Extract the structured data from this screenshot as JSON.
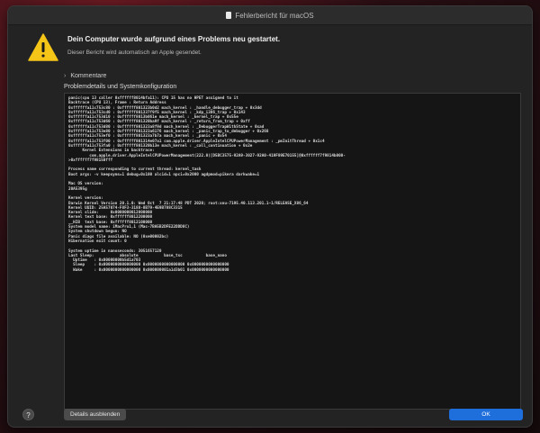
{
  "window": {
    "title": "Fehlerbericht für macOS"
  },
  "header": {
    "headline": "Dein Computer wurde aufgrund eines Problems neu gestartet.",
    "subline": "Dieser Bericht wird automatisch an Apple gesendet."
  },
  "comments": {
    "label": "Kommentare"
  },
  "details": {
    "section_label": "Problemdetails und Systemkonfiguration",
    "report_lines": [
      "panic(cpu 13 caller 0xffffff8014bfa11): CPU 15 has no HPET assigned to it",
      "Backtrace (CPU 13), Frame : Return Address",
      "0xffffffa11c753c80 : 0xffffff801323b0d2 mach_kernel : _handle_debugger_trap + 0x3dd",
      "0xffffffa11c753cd0 : 0xffffff801337f9f5 mach_kernel : _kdp_i386_trap + 0x143",
      "0xffffffa11c753d10 : 0xffffff8013b061e mach_kernel : _kernel_trap + 0x55e",
      "0xffffffa11c753d60 : 0xffffff801320ba9f mach_kernel : _return_from_trap + 0xff",
      "0xffffffa11c753d80 : 0xffffff801323a8f9d mach_kernel : _DebuggerTrapWithState + 0xad",
      "0xffffffa11c753e80 : 0xffffff801323a6176 mach_kernel : _panic_trap_to_debugger + 0x268",
      "0xffffffa11c753ef0 : 0xffffff801323a7b7a mach_kernel : _panic + 0x54",
      "0xffffffa11c753f00 : 0xffffff801314e07a1 com.apple.driver.AppleIntelCPUPowerManagement : _pmInitThread + 0x1c4",
      "0xffffffa11c753fa0 : 0xffffff801320b13e mach_kernel : _call_continuation + 0x2e",
      "      Kernel Extensions in backtrace:",
      "         com.apple.driver.AppleIntelCPUPowerManagement(222.0)[D5BC3575-92A9-3027-92A0-419F89E70155]@0xffffff7f9814b000-",
      ">0xffffff7f98150fff",
      "",
      "Process name corresponding to current thread: kernel_task",
      "Boot args: -v keepsyms=1 debug=0x100 alcid=1 npci=0x2000 agdpmod=pikera darkwake=1",
      "",
      "Mac OS version:",
      "20A5395g",
      "",
      "Kernel version:",
      "Darwin Kernel Version 20.1.0: Wed Oct  7 21:17:48 PDT 2020; root:xnu-7195.40.113.201.1~1/RELEASE_X86_64",
      "Kernel UUID: 25A57074-F8F3-3188-8B79-4E9B788C3315",
      "Kernel slide:     0x0000000012000000",
      "Kernel text base: 0xffffff8012200000",
      "__HIB  text base: 0xffffff8012100000",
      "System model name: iMacPro1,1 (Mac-7BA5B2DFE22DDD8C)",
      "System shutdown begun: NO",
      "Panic diags file available: NO (0xe00002bc)",
      "Hibernation exit count: 0",
      "",
      "System uptime in nanoseconds: 3051657120",
      "Last Sleep:           absolute           base_tsc          base_nano",
      "  Uptime   : 0x00000000b5d1a703",
      "  Sleep    : 0x0000000000000000 0x0000000000000000 0x0000000000000000",
      "  Wake     : 0x0000000000000000 0x000000001a1d3b01 0x0000000000000000"
    ]
  },
  "footer": {
    "help_label": "?",
    "details_button": "Details ausblenden",
    "ok_button": "OK"
  },
  "colors": {
    "accent": "#1e6fdc",
    "warning": "#f5c518"
  },
  "icons": {
    "warning": "warning-triangle-icon",
    "document": "document-icon",
    "disclosure": "chevron-right-icon"
  }
}
